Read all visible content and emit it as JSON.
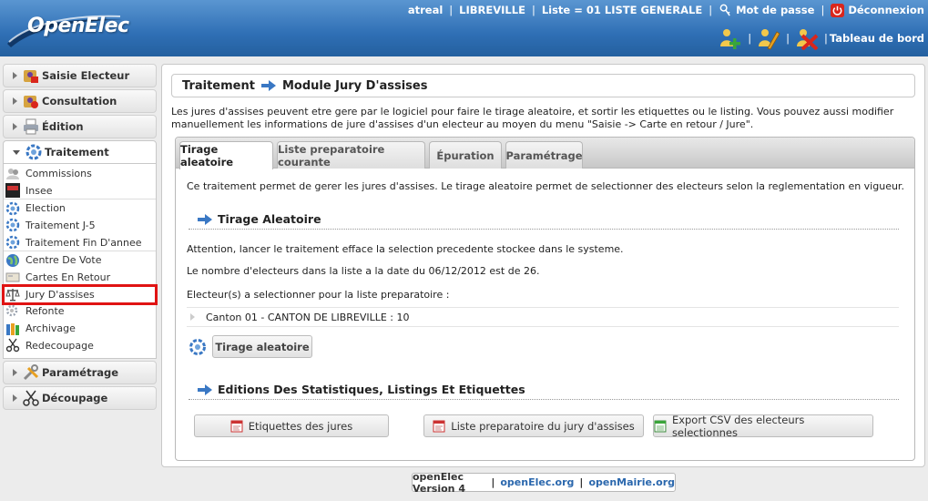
{
  "app": {
    "name": "OpenElec"
  },
  "header": {
    "user": "atreal",
    "city": "LIBREVILLE",
    "list": "Liste = 01 LISTE GENERALE",
    "password_label": "Mot de passe",
    "logout_label": "Déconnexion",
    "dashboard_label": "Tableau de bord"
  },
  "sidebar": {
    "sections": [
      {
        "label": "Saisie Electeur"
      },
      {
        "label": "Consultation"
      },
      {
        "label": "Édition"
      },
      {
        "label": "Traitement"
      },
      {
        "label": "Paramétrage"
      },
      {
        "label": "Découpage"
      }
    ],
    "traitement_items": [
      {
        "label": "Commissions"
      },
      {
        "label": "Insee"
      },
      {
        "label": "Election"
      },
      {
        "label": "Traitement J-5"
      },
      {
        "label": "Traitement Fin D'annee"
      },
      {
        "label": "Centre De Vote"
      },
      {
        "label": "Cartes En Retour"
      },
      {
        "label": "Jury D'assises"
      },
      {
        "label": "Refonte"
      },
      {
        "label": "Archivage"
      },
      {
        "label": "Redecoupage"
      }
    ],
    "highlight_color": "#e01313"
  },
  "main": {
    "breadcrumb": {
      "section": "Traitement",
      "page": "Module Jury D'assises"
    },
    "intro": "Les jures d'assises peuvent etre gere par le logiciel pour faire le tirage aleatoire, et sortir les etiquettes ou le listing. Vous pouvez aussi modifier manuellement les informations de jure d'assises d'un electeur au moyen du menu \"Saisie -> Carte en retour / Jure\".",
    "tabs": [
      {
        "label": "Tirage aleatoire",
        "active": true
      },
      {
        "label": "Liste preparatoire courante",
        "active": false
      },
      {
        "label": "Épuration",
        "active": false
      },
      {
        "label": "Paramétrage",
        "active": false
      }
    ],
    "tab_content": {
      "description": "Ce traitement permet de gerer les jures d'assises. Le tirage aleatoire permet de selectionner des electeurs selon la reglementation en vigueur.",
      "section1_title": "Tirage Aleatoire",
      "warning": "Attention, lancer le traitement efface la selection precedente stockee dans le systeme.",
      "count_text": "Le nombre d'electeurs dans la liste a la date du 06/12/2012 est de 26.",
      "select_label": "Electeur(s) a selectionner pour la liste preparatoire :",
      "canton_line": "Canton 01 - CANTON DE LIBREVILLE : 10",
      "run_button": "Tirage aleatoire",
      "section2_title": "Editions Des Statistiques, Listings Et Etiquettes",
      "edition_buttons": [
        {
          "label": "Etiquettes des jures",
          "icon": "pdf-icon"
        },
        {
          "label": "Liste preparatoire du jury d'assises",
          "icon": "pdf-icon"
        },
        {
          "label": "Export CSV des electeurs selectionnes",
          "icon": "csv-icon"
        }
      ]
    }
  },
  "footer": {
    "version": "openElec Version 4",
    "link1": "openElec.org",
    "link2": "openMairie.org"
  },
  "colors": {
    "header_blue": "#2f6fb5",
    "link_blue": "#2a67ad",
    "accent_arrow": "#3a78c4"
  }
}
